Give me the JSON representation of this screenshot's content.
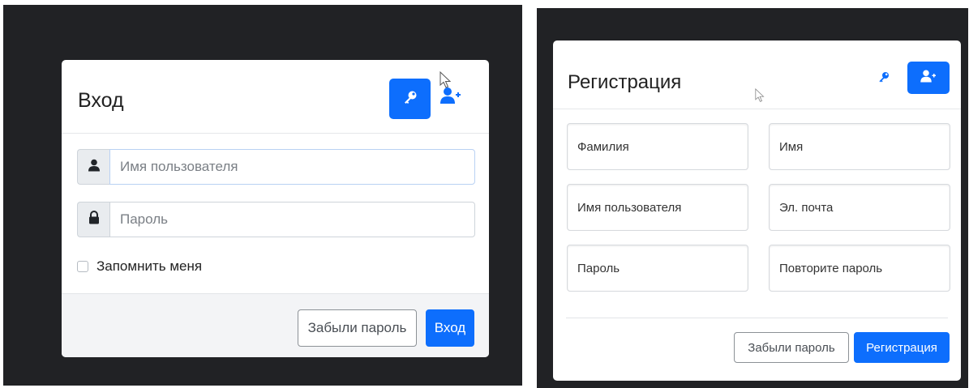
{
  "login": {
    "title": "Вход",
    "key_button_icon": "key-icon",
    "register_switch_icon": "user-plus-icon",
    "username": {
      "icon": "user-icon",
      "placeholder": "Имя пользователя"
    },
    "password": {
      "icon": "lock-icon",
      "placeholder": "Пароль"
    },
    "remember_label": "Запомнить меня",
    "forgot_label": "Забыли пароль",
    "submit_label": "Вход"
  },
  "register": {
    "title": "Регистрация",
    "login_switch_icon": "key-icon",
    "user_button_icon": "user-plus-icon",
    "fields": [
      "Фамилия",
      "Имя",
      "Имя пользователя",
      "Эл. почта",
      "Пароль",
      "Повторите пароль"
    ],
    "forgot_label": "Забыли пароль",
    "submit_label": "Регистрация"
  },
  "colors": {
    "primary": "#0d6efd",
    "background": "#212225",
    "card": "#ffffff"
  }
}
